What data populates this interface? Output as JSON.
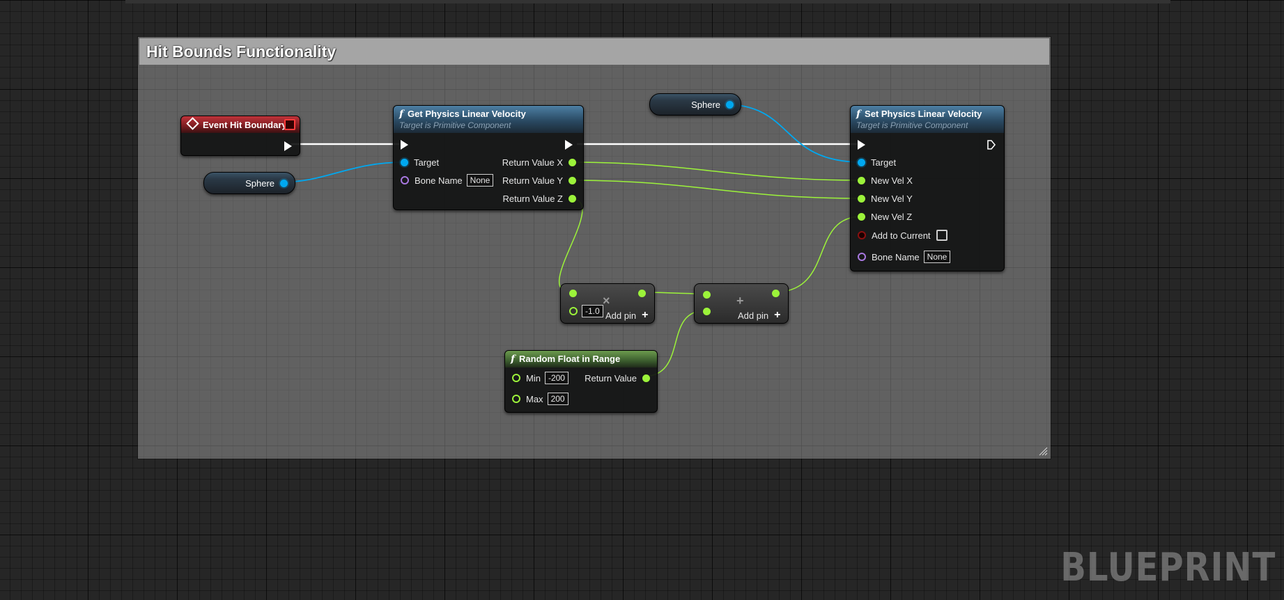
{
  "comment": {
    "title": "Hit Bounds Functionality"
  },
  "nodes": {
    "event_hit_boundary": {
      "title": "Event Hit Boundary"
    },
    "sphere_var_left": {
      "label": "Sphere"
    },
    "sphere_var_top": {
      "label": "Sphere"
    },
    "get_velocity": {
      "title": "Get Physics Linear Velocity",
      "subtitle": "Target is Primitive Component",
      "target_label": "Target",
      "bone_name_label": "Bone Name",
      "bone_name_value": "None",
      "return_x": "Return Value X",
      "return_y": "Return Value Y",
      "return_z": "Return Value Z"
    },
    "set_velocity": {
      "title": "Set Physics Linear Velocity",
      "subtitle": "Target is Primitive Component",
      "target_label": "Target",
      "new_vel_x": "New Vel X",
      "new_vel_y": "New Vel Y",
      "new_vel_z": "New Vel Z",
      "add_to_current": "Add to Current",
      "bone_name_label": "Bone Name",
      "bone_name_value": "None"
    },
    "multiply": {
      "value": "-1.0",
      "add_pin": "Add pin"
    },
    "add": {
      "add_pin": "Add pin"
    },
    "random_float": {
      "title": "Random Float in Range",
      "min_label": "Min",
      "min_value": "-200",
      "max_label": "Max",
      "max_value": "200",
      "return_label": "Return Value"
    }
  },
  "watermark": "BLUEPRINT",
  "colors": {
    "exec_wire": "#ffffff",
    "object_wire": "#00a8f0",
    "float_wire": "#9cf33a",
    "name_pin": "#a878e0",
    "bool_pin": "#8a1010"
  }
}
